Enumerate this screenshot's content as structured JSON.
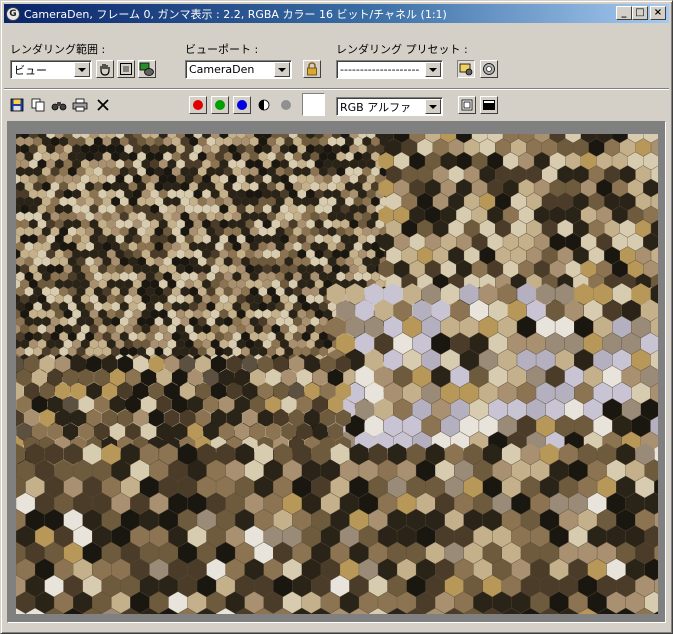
{
  "window": {
    "title": "CameraDen, フレーム 0, ガンマ表示 : 2.2, RGBA カラー 16 ビット/チャネル (1:1)",
    "icon_glyph": "G",
    "buttons": {
      "minimize": "_",
      "maximize": "□",
      "close": "×"
    }
  },
  "toolbar1": {
    "render_area": {
      "label": "レンダリング範囲 :",
      "value": "ビュー"
    },
    "viewport": {
      "label": "ビューポート :",
      "value": "CameraDen"
    },
    "preset": {
      "label": "レンダリング プリセット :",
      "value": "--------------------"
    }
  },
  "toolbar2": {
    "channels": [
      "red",
      "green",
      "blue"
    ],
    "channel_colors": {
      "red": "#e00000",
      "green": "#00a000",
      "blue": "#0000e0",
      "alpha": "#909090"
    },
    "display_channel": "RGB アルファ",
    "swatch_color": "#ffffff"
  },
  "render": {
    "description_icon": "rendered-image",
    "palette": [
      "#2a2418",
      "#4a3c28",
      "#6e5a3c",
      "#8c7452",
      "#a89070",
      "#c4b08a",
      "#d8ccb0",
      "#1a1610",
      "#b89858",
      "#9a8a78",
      "#c8c4d4",
      "#b4b0c0",
      "#e8e4dc",
      "#5c5040",
      "#7a6a50",
      "#3c3428"
    ]
  }
}
